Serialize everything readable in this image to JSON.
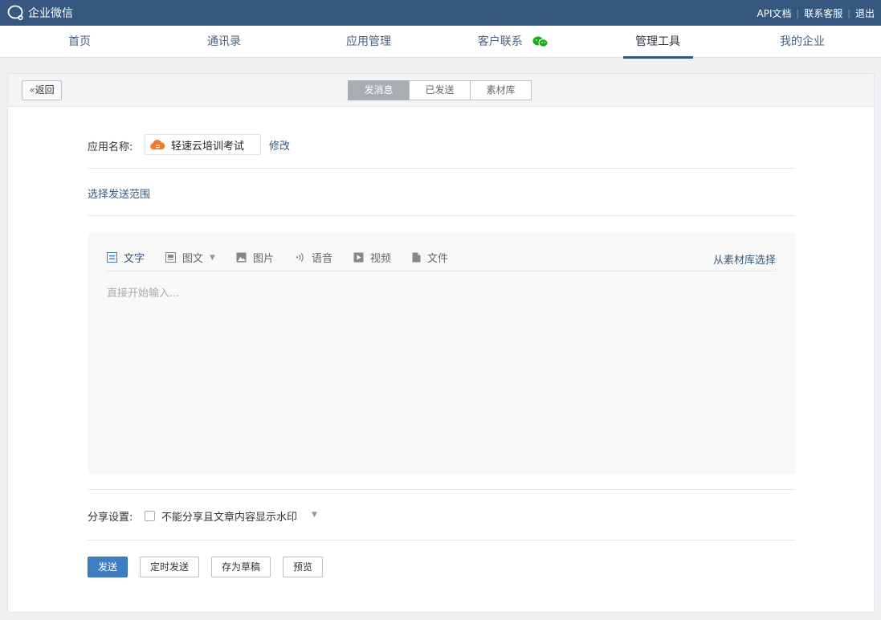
{
  "topbar": {
    "brand": "企业微信",
    "links": [
      "API文档",
      "联系客服",
      "退出"
    ]
  },
  "nav": {
    "items": [
      "首页",
      "通讯录",
      "应用管理",
      "客户联系",
      "管理工具",
      "我的企业"
    ],
    "active": "管理工具"
  },
  "header": {
    "back_label": "返回",
    "tabs": [
      "发消息",
      "已发送",
      "素材库"
    ],
    "active_tab": "发消息"
  },
  "form": {
    "app_label": "应用名称:",
    "app_name": "轻速云培训考试",
    "modify": "修改",
    "scope_link": "选择发送范围"
  },
  "editor": {
    "tools": [
      {
        "label": "文字",
        "icon": "text-icon",
        "active": true
      },
      {
        "label": "图文",
        "icon": "article-icon",
        "dropdown": true
      },
      {
        "label": "图片",
        "icon": "image-icon"
      },
      {
        "label": "语音",
        "icon": "voice-icon"
      },
      {
        "label": "视频",
        "icon": "video-icon"
      },
      {
        "label": "文件",
        "icon": "file-icon"
      }
    ],
    "library_link": "从素材库选择",
    "placeholder": "直接开始输入..."
  },
  "share": {
    "label": "分享设置:",
    "option": "不能分享且文章内容显示水印"
  },
  "actions": {
    "send": "发送",
    "schedule": "定时发送",
    "draft": "存为草稿",
    "preview": "预览"
  },
  "colors": {
    "topbar": "#36577f",
    "primary_button": "#3d7fc2",
    "link": "#36577f",
    "app_icon": "#f07a2a",
    "wechat_icon": "#1aad19"
  }
}
